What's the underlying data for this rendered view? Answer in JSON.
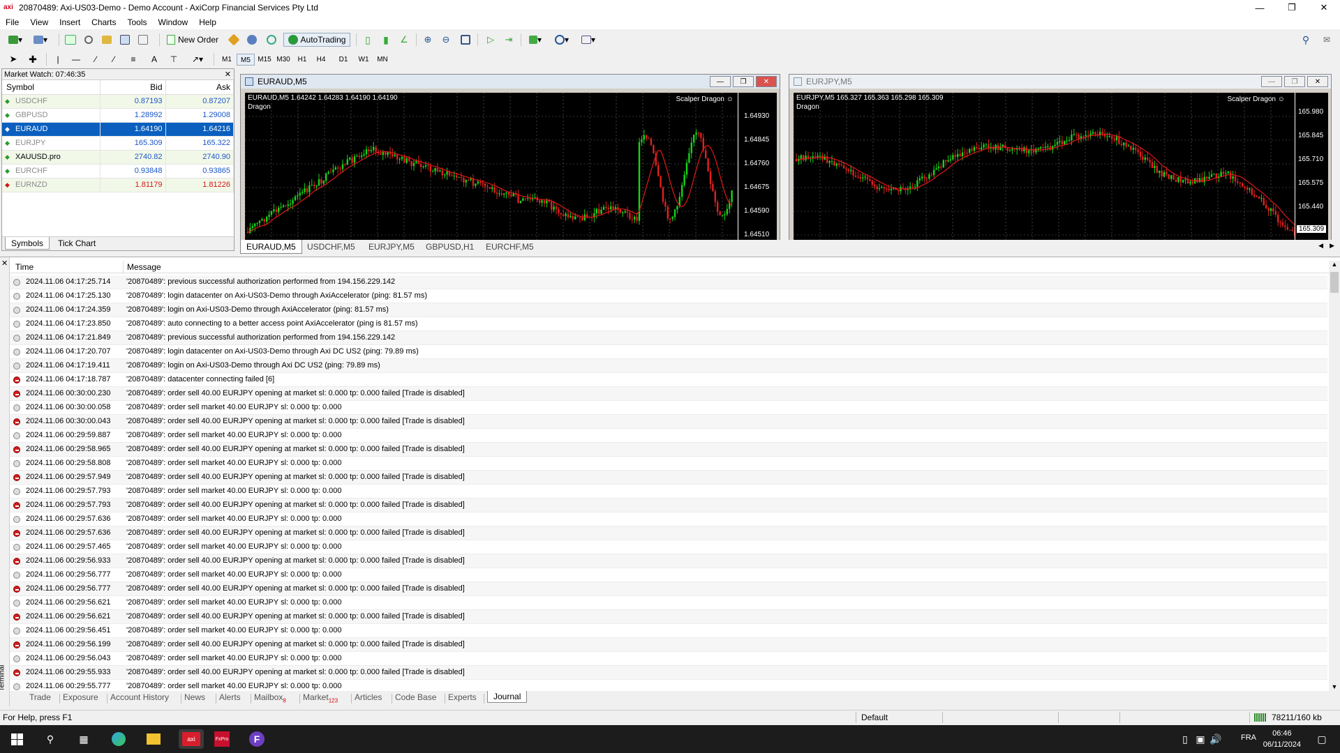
{
  "window": {
    "title": "20870489: Axi-US03-Demo - Demo Account - AxiCorp Financial Services Pty Ltd",
    "logo": "axi"
  },
  "menu": [
    "File",
    "View",
    "Insert",
    "Charts",
    "Tools",
    "Window",
    "Help"
  ],
  "toolbar": {
    "new_order": "New Order",
    "autotrading": "AutoTrading",
    "timeframes": [
      "M1",
      "M5",
      "M15",
      "M30",
      "H1",
      "H4",
      "D1",
      "W1",
      "MN"
    ],
    "selected_timeframe": "M5"
  },
  "market_watch": {
    "title": "Market Watch: 07:46:35",
    "columns": [
      "Symbol",
      "Bid",
      "Ask"
    ],
    "rows": [
      {
        "symbol": "USDCHF",
        "bid": "0.87193",
        "ask": "0.87207",
        "dir": "up",
        "color": "#1a56c8"
      },
      {
        "symbol": "GBPUSD",
        "bid": "1.28992",
        "ask": "1.29008",
        "dir": "up",
        "color": "#1a56c8"
      },
      {
        "symbol": "EURAUD",
        "bid": "1.64190",
        "ask": "1.64216",
        "dir": "down",
        "color": "#ffffff"
      },
      {
        "symbol": "EURJPY",
        "bid": "165.309",
        "ask": "165.322",
        "dir": "up",
        "color": "#1a56c8"
      },
      {
        "symbol": "XAUUSD.pro",
        "bid": "2740.82",
        "ask": "2740.90",
        "dir": "up",
        "color": "#1a56c8"
      },
      {
        "symbol": "EURCHF",
        "bid": "0.93848",
        "ask": "0.93865",
        "dir": "up",
        "color": "#1a56c8"
      },
      {
        "symbol": "EURNZD",
        "bid": "1.81179",
        "ask": "1.81226",
        "dir": "down",
        "color": "#d01818"
      }
    ],
    "tabs": [
      "Symbols",
      "Tick Chart"
    ]
  },
  "charts": [
    {
      "caption": "EURAUD,M5",
      "ohlc": "EURAUD,M5  1.64242 1.64283 1.64190 1.64190",
      "indicator": "Dragon",
      "ea": "Scalper Dragon ☺",
      "axis": [
        "1.64930",
        "1.64845",
        "1.64760",
        "1.64675",
        "1.64590",
        "1.64510"
      ],
      "current_price": ""
    },
    {
      "caption": "EURJPY,M5",
      "ohlc": "EURJPY,M5  165.327 165.363 165.298 165.309",
      "indicator": "Dragon",
      "ea": "Scalper Dragon ☺",
      "axis": [
        "165.980",
        "165.845",
        "165.710",
        "165.575",
        "165.440"
      ],
      "current_price": "165.309"
    }
  ],
  "chart_tabs": [
    "EURAUD,M5",
    "USDCHF,M5",
    "EURJPY,M5",
    "GBPUSD,H1",
    "EURCHF,M5"
  ],
  "journal": {
    "columns": [
      "Time",
      "Message"
    ],
    "rows": [
      {
        "type": "info",
        "time": "2024.11.06 04:17:25.714",
        "msg": "'20870489': previous successful authorization performed from 194.156.229.142"
      },
      {
        "type": "info",
        "time": "2024.11.06 04:17:25.130",
        "msg": "'20870489': login datacenter on Axi-US03-Demo through AxiAccelerator (ping: 81.57 ms)"
      },
      {
        "type": "info",
        "time": "2024.11.06 04:17:24.359",
        "msg": "'20870489': login on Axi-US03-Demo through AxiAccelerator (ping: 81.57 ms)"
      },
      {
        "type": "info",
        "time": "2024.11.06 04:17:23.850",
        "msg": "'20870489': auto connecting to a better access point AxiAccelerator (ping is 81.57 ms)"
      },
      {
        "type": "info",
        "time": "2024.11.06 04:17:21.849",
        "msg": "'20870489': previous successful authorization performed from 194.156.229.142"
      },
      {
        "type": "info",
        "time": "2024.11.06 04:17:20.707",
        "msg": "'20870489': login datacenter on Axi-US03-Demo through Axi DC US2 (ping: 79.89 ms)"
      },
      {
        "type": "info",
        "time": "2024.11.06 04:17:19.411",
        "msg": "'20870489': login on Axi-US03-Demo through Axi DC US2 (ping: 79.89 ms)"
      },
      {
        "type": "err",
        "time": "2024.11.06 04:17:18.787",
        "msg": "'20870489': datacenter connecting failed [6]"
      },
      {
        "type": "err",
        "time": "2024.11.06 00:30:00.230",
        "msg": "'20870489': order sell 40.00 EURJPY opening at market sl: 0.000 tp: 0.000 failed [Trade is disabled]"
      },
      {
        "type": "info",
        "time": "2024.11.06 00:30:00.058",
        "msg": "'20870489': order sell market 40.00 EURJPY sl: 0.000 tp: 0.000"
      },
      {
        "type": "err",
        "time": "2024.11.06 00:30:00.043",
        "msg": "'20870489': order sell 40.00 EURJPY opening at market sl: 0.000 tp: 0.000 failed [Trade is disabled]"
      },
      {
        "type": "info",
        "time": "2024.11.06 00:29:59.887",
        "msg": "'20870489': order sell market 40.00 EURJPY sl: 0.000 tp: 0.000"
      },
      {
        "type": "err",
        "time": "2024.11.06 00:29:58.965",
        "msg": "'20870489': order sell 40.00 EURJPY opening at market sl: 0.000 tp: 0.000 failed [Trade is disabled]"
      },
      {
        "type": "info",
        "time": "2024.11.06 00:29:58.808",
        "msg": "'20870489': order sell market 40.00 EURJPY sl: 0.000 tp: 0.000"
      },
      {
        "type": "err",
        "time": "2024.11.06 00:29:57.949",
        "msg": "'20870489': order sell 40.00 EURJPY opening at market sl: 0.000 tp: 0.000 failed [Trade is disabled]"
      },
      {
        "type": "info",
        "time": "2024.11.06 00:29:57.793",
        "msg": "'20870489': order sell market 40.00 EURJPY sl: 0.000 tp: 0.000"
      },
      {
        "type": "err",
        "time": "2024.11.06 00:29:57.793",
        "msg": "'20870489': order sell 40.00 EURJPY opening at market sl: 0.000 tp: 0.000 failed [Trade is disabled]"
      },
      {
        "type": "info",
        "time": "2024.11.06 00:29:57.636",
        "msg": "'20870489': order sell market 40.00 EURJPY sl: 0.000 tp: 0.000"
      },
      {
        "type": "err",
        "time": "2024.11.06 00:29:57.636",
        "msg": "'20870489': order sell 40.00 EURJPY opening at market sl: 0.000 tp: 0.000 failed [Trade is disabled]"
      },
      {
        "type": "info",
        "time": "2024.11.06 00:29:57.465",
        "msg": "'20870489': order sell market 40.00 EURJPY sl: 0.000 tp: 0.000"
      },
      {
        "type": "err",
        "time": "2024.11.06 00:29:56.933",
        "msg": "'20870489': order sell 40.00 EURJPY opening at market sl: 0.000 tp: 0.000 failed [Trade is disabled]"
      },
      {
        "type": "info",
        "time": "2024.11.06 00:29:56.777",
        "msg": "'20870489': order sell market 40.00 EURJPY sl: 0.000 tp: 0.000"
      },
      {
        "type": "err",
        "time": "2024.11.06 00:29:56.777",
        "msg": "'20870489': order sell 40.00 EURJPY opening at market sl: 0.000 tp: 0.000 failed [Trade is disabled]"
      },
      {
        "type": "info",
        "time": "2024.11.06 00:29:56.621",
        "msg": "'20870489': order sell market 40.00 EURJPY sl: 0.000 tp: 0.000"
      },
      {
        "type": "err",
        "time": "2024.11.06 00:29:56.621",
        "msg": "'20870489': order sell 40.00 EURJPY opening at market sl: 0.000 tp: 0.000 failed [Trade is disabled]"
      },
      {
        "type": "info",
        "time": "2024.11.06 00:29:56.451",
        "msg": "'20870489': order sell market 40.00 EURJPY sl: 0.000 tp: 0.000"
      },
      {
        "type": "err",
        "time": "2024.11.06 00:29:56.199",
        "msg": "'20870489': order sell 40.00 EURJPY opening at market sl: 0.000 tp: 0.000 failed [Trade is disabled]"
      },
      {
        "type": "info",
        "time": "2024.11.06 00:29:56.043",
        "msg": "'20870489': order sell market 40.00 EURJPY sl: 0.000 tp: 0.000"
      },
      {
        "type": "err",
        "time": "2024.11.06 00:29:55.933",
        "msg": "'20870489': order sell 40.00 EURJPY opening at market sl: 0.000 tp: 0.000 failed [Trade is disabled]"
      },
      {
        "type": "info",
        "time": "2024.11.06 00:29:55.777",
        "msg": "'20870489': order sell market 40.00 EURJPY sl: 0.000 tp: 0.000"
      }
    ]
  },
  "terminal_tabs": [
    {
      "label": "Trade",
      "badge": ""
    },
    {
      "label": "Exposure",
      "badge": ""
    },
    {
      "label": "Account History",
      "badge": ""
    },
    {
      "label": "News",
      "badge": ""
    },
    {
      "label": "Alerts",
      "badge": ""
    },
    {
      "label": "Mailbox",
      "badge": "8"
    },
    {
      "label": "Market",
      "badge": "123"
    },
    {
      "label": "Articles",
      "badge": ""
    },
    {
      "label": "Code Base",
      "badge": ""
    },
    {
      "label": "Experts",
      "badge": ""
    },
    {
      "label": "Journal",
      "badge": ""
    }
  ],
  "terminal_side_label": "Terminal",
  "statusbar": {
    "help": "For Help, press F1",
    "profile": "Default",
    "traffic": "78211/160 kb"
  },
  "taskbar": {
    "lang": "FRA",
    "time": "06:46",
    "date": "06/11/2024"
  }
}
